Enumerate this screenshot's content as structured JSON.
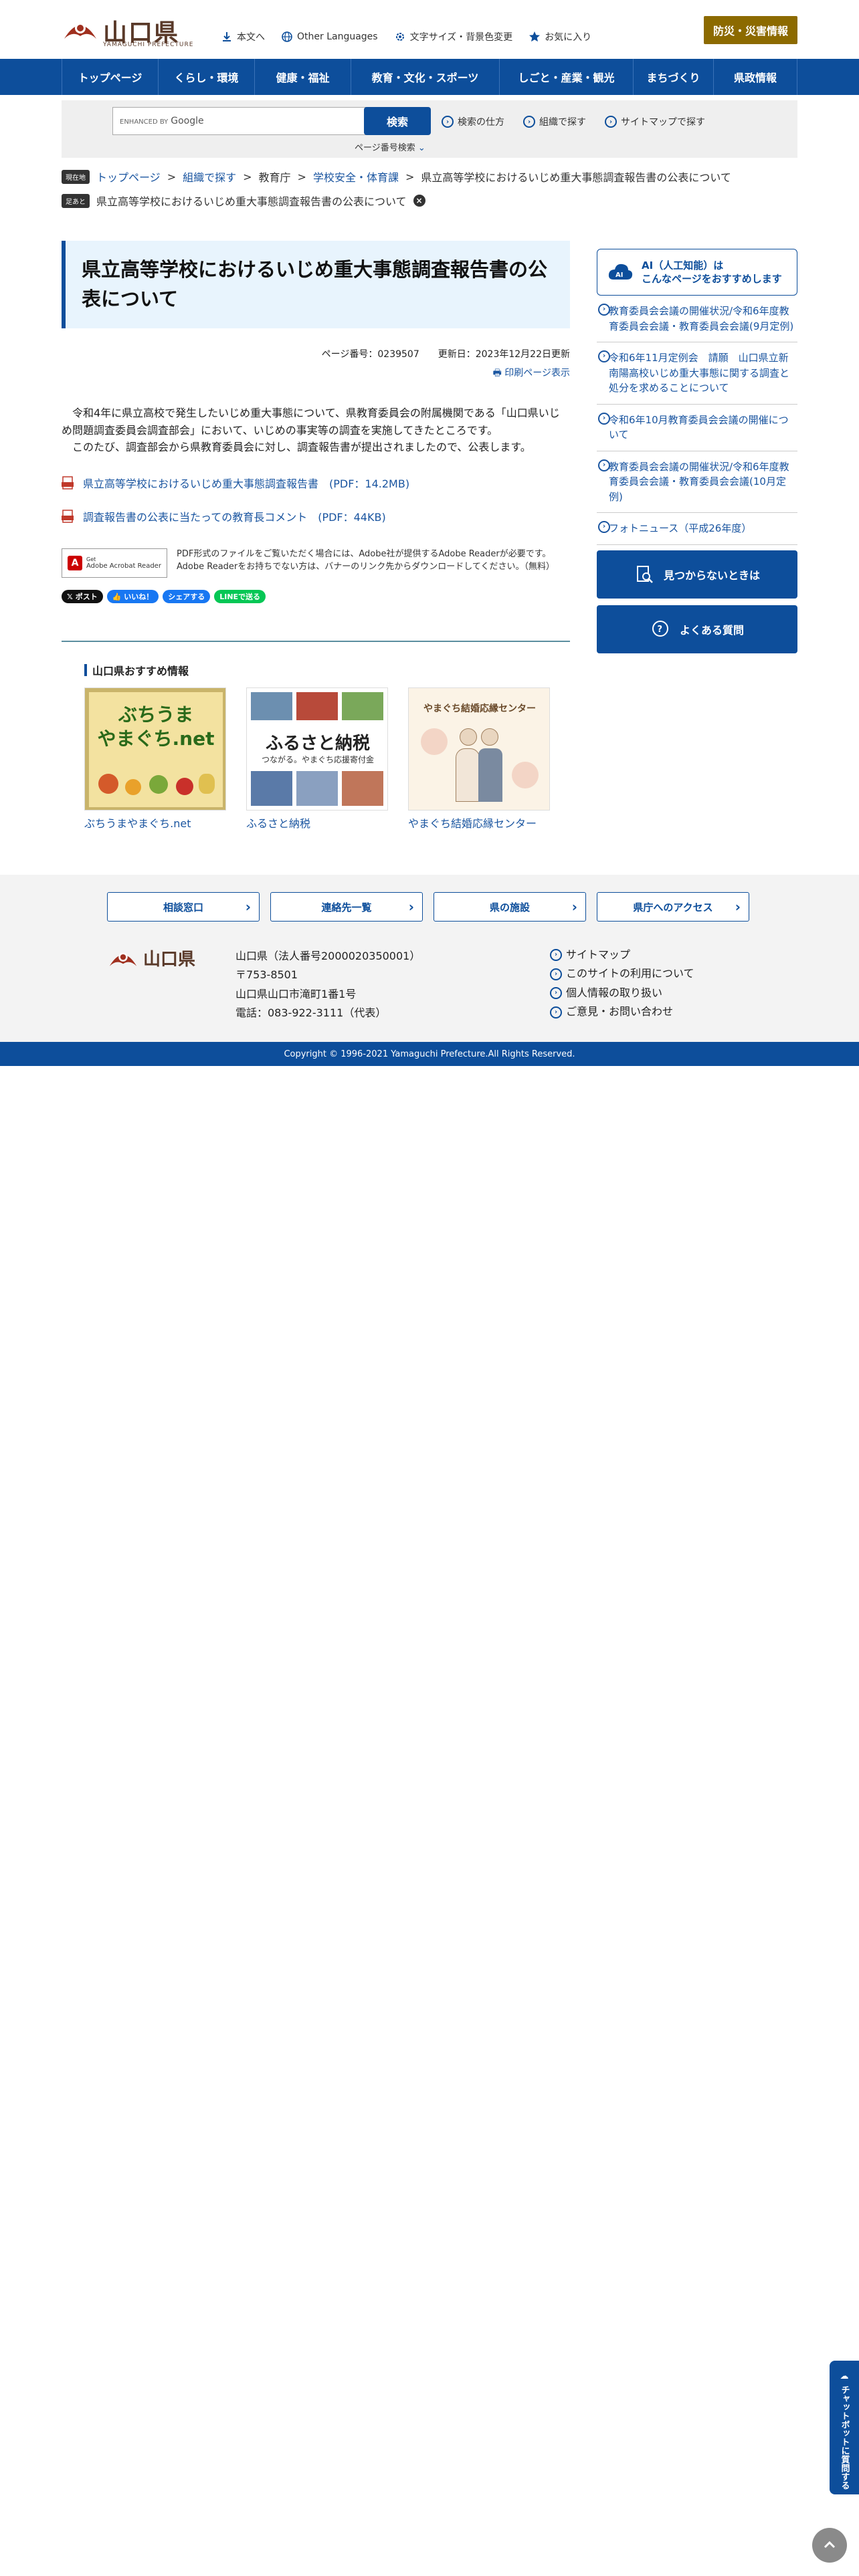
{
  "header": {
    "logo_name": "山口県",
    "logo_sub": "YAMAGUCHI PREFECTURE",
    "util_links": [
      "本文へ",
      "Other Languages",
      "文字サイズ・背景色変更",
      "お気に入り"
    ],
    "disaster_button": "防災・災害情報"
  },
  "gnav": [
    "トップページ",
    "くらし・環境",
    "健康・福祉",
    "教育・文化・スポーツ",
    "しごと・産業・観光",
    "まちづくり",
    "県政情報"
  ],
  "search": {
    "google_tag": "ENHANCED BY",
    "google_word": "Google",
    "button": "検索",
    "links": [
      "検索の仕方",
      "組織で探す",
      "サイトマップで探す"
    ],
    "pageno_search": "ページ番号検索"
  },
  "breadcrumb": {
    "badge1": "現在地",
    "items": [
      "トップページ",
      "組織で探す",
      "教育庁",
      "学校安全・体育課",
      "県立高等学校におけるいじめ重大事態調査報告書の公表について"
    ],
    "badge2": "足あと",
    "history": "県立高等学校におけるいじめ重大事態調査報告書の公表について"
  },
  "main": {
    "title": "県立高等学校におけるいじめ重大事態調査報告書の公表について",
    "page_no": "ページ番号：0239507　　更新日：2023年12月22日更新",
    "print": "印刷ページ表示",
    "para1": "　令和4年に県立高校で発生したいじめ重大事態について、県教育委員会の附属機関である「山口県いじめ問題調査委員会調査部会」において、いじめの事実等の調査を実施してきたところです。",
    "para2": "　このたび、調査部会から県教育委員会に対し、調査報告書が提出されましたので、公表します。",
    "pdf1": "県立高等学校におけるいじめ重大事態調査報告書　(PDF：14.2MB)",
    "pdf2": "調査報告書の公表に当たっての教育長コメント　(PDF：44KB)",
    "adobe_banner_small": "Get",
    "adobe_banner": "Adobe Acrobat Reader",
    "adobe_text1": "PDF形式のファイルをご覧いただく場合には、Adobe社が提供するAdobe Readerが必要です。",
    "adobe_text2": "Adobe Readerをお持ちでない方は、バナーのリンク先からダウンロードしてください。（無料）",
    "social": [
      "𝕏 ポスト",
      "👍 いいね！",
      "シェアする",
      "LINEで送る"
    ]
  },
  "recommend": {
    "heading": "山口県おすすめ情報",
    "items": [
      {
        "caption": "ぶちうまやまぐち.net",
        "img_text": "ぶちうま\nやまぐち.net"
      },
      {
        "caption": "ふるさと納税",
        "img_text": "ふるさと納税",
        "img_sub": "つながる。やまぐち応援寄付金"
      },
      {
        "caption": "やまぐち結婚応縁センター",
        "img_text": "やまぐち結婚応縁センター"
      }
    ]
  },
  "sidebar": {
    "ai_title_1": "AI（人工知能）は",
    "ai_title_2": "こんなページをおすすめします",
    "ai_icon_text": "AI",
    "items": [
      "教育委員会会議の開催状況/令和6年度教育委員会会議・教育委員会会議(9月定例)",
      "令和6年11月定例会　請願　山口県立新南陽高校いじめ重大事態に関する調査と処分を求めることについて",
      "令和6年10月教育委員会会議の開催について",
      "教育委員会会議の開催状況/令和6年度教育委員会会議・教育委員会会議(10月定例)",
      "フォトニュース（平成26年度）"
    ],
    "btn_notfound": "見つからないときは",
    "btn_faq": "よくある質問"
  },
  "footer": {
    "buttons": [
      "相談窓口",
      "連絡先一覧",
      "県の施設",
      "県庁へのアクセス"
    ],
    "logo_name": "山口県",
    "addr": [
      "山口県（法人番号2000020350001）",
      "〒753-8501",
      "山口県山口市滝町1番1号",
      "電話：083-922-3111（代表）"
    ],
    "links": [
      "サイトマップ",
      "このサイトの利用について",
      "個人情報の取り扱い",
      "ご意見・お問い合わせ"
    ],
    "copyright": "Copyright © 1996-2021 Yamaguchi Prefecture.All Rights Reserved."
  },
  "chatbot": "チャットボットに質問する",
  "colors": {
    "primary": "#0d4e9b",
    "disaster": "#8c6a00",
    "title_bg": "#e8f4fd",
    "logo_brown": "#5a3a2a"
  }
}
